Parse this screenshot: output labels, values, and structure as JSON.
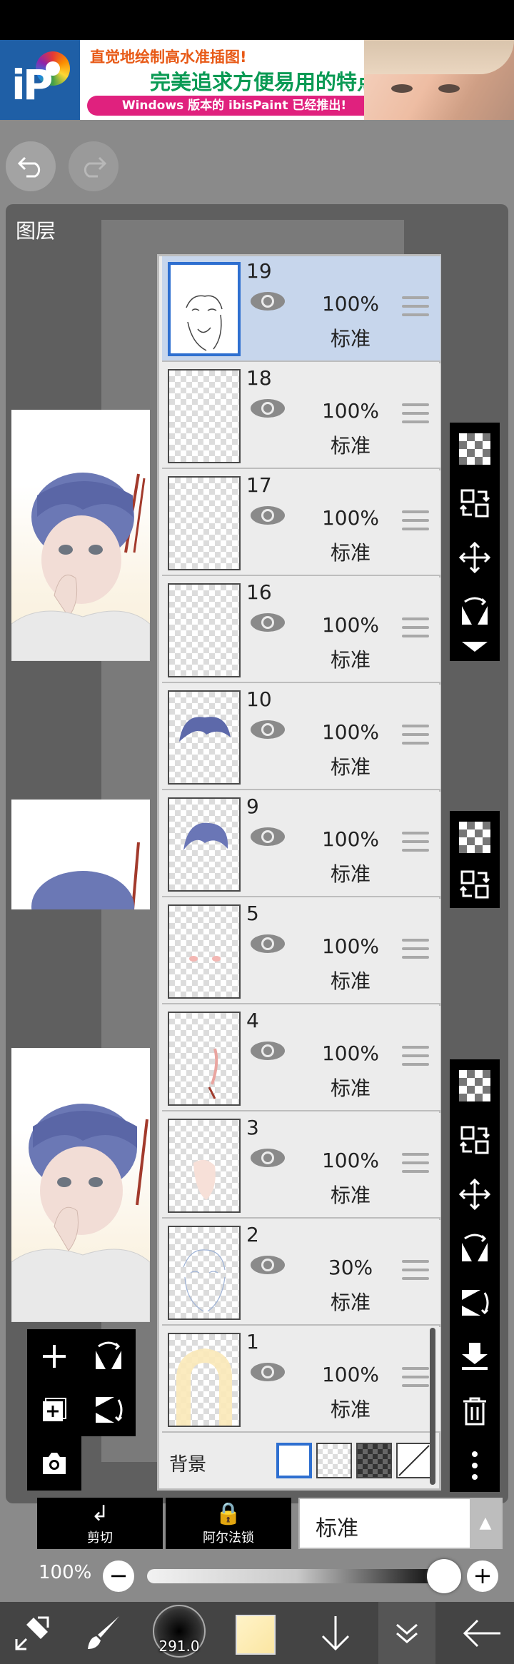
{
  "ad": {
    "line1": "直觉地绘制高水准插图!",
    "line2": "完美追求方便易用的特点!",
    "line3": "Windows 版本的 ibisPaint 已经推出!",
    "logo_text": "iP"
  },
  "toolbar": {
    "undo_icon": "undo-arrow",
    "redo_icon": "redo-arrow"
  },
  "panel": {
    "title": "图层"
  },
  "layers": [
    {
      "number": "19",
      "opacity": "100%",
      "blend": "标准",
      "selected": true
    },
    {
      "number": "18",
      "opacity": "100%",
      "blend": "标准",
      "selected": false
    },
    {
      "number": "17",
      "opacity": "100%",
      "blend": "标准",
      "selected": false
    },
    {
      "number": "16",
      "opacity": "100%",
      "blend": "标准",
      "selected": false
    },
    {
      "number": "10",
      "opacity": "100%",
      "blend": "标准",
      "selected": false
    },
    {
      "number": "9",
      "opacity": "100%",
      "blend": "标准",
      "selected": false
    },
    {
      "number": "5",
      "opacity": "100%",
      "blend": "标准",
      "selected": false
    },
    {
      "number": "4",
      "opacity": "100%",
      "blend": "标准",
      "selected": false
    },
    {
      "number": "3",
      "opacity": "100%",
      "blend": "标准",
      "selected": false
    },
    {
      "number": "2",
      "opacity": "30%",
      "blend": "标准",
      "selected": false
    },
    {
      "number": "1",
      "opacity": "100%",
      "blend": "标准",
      "selected": false
    }
  ],
  "background": {
    "label": "背景",
    "options": [
      "white",
      "transparent-light",
      "transparent-dark",
      "none"
    ],
    "selected": "white"
  },
  "blend_bar": {
    "clip_label": "剪切",
    "alpha_lock_label": "阿尔法锁",
    "blend_mode": "标准"
  },
  "opacity_bar": {
    "value": "100%",
    "minus": "−",
    "plus": "+",
    "slider_fraction": 1.0
  },
  "bottom_bar": {
    "brush_size": "291.0"
  },
  "colors": {
    "accent": "#2e6fd0",
    "selected_layer": "#c7d6ec",
    "panel": "#5f5f5f",
    "hair": "#6b78b5"
  }
}
